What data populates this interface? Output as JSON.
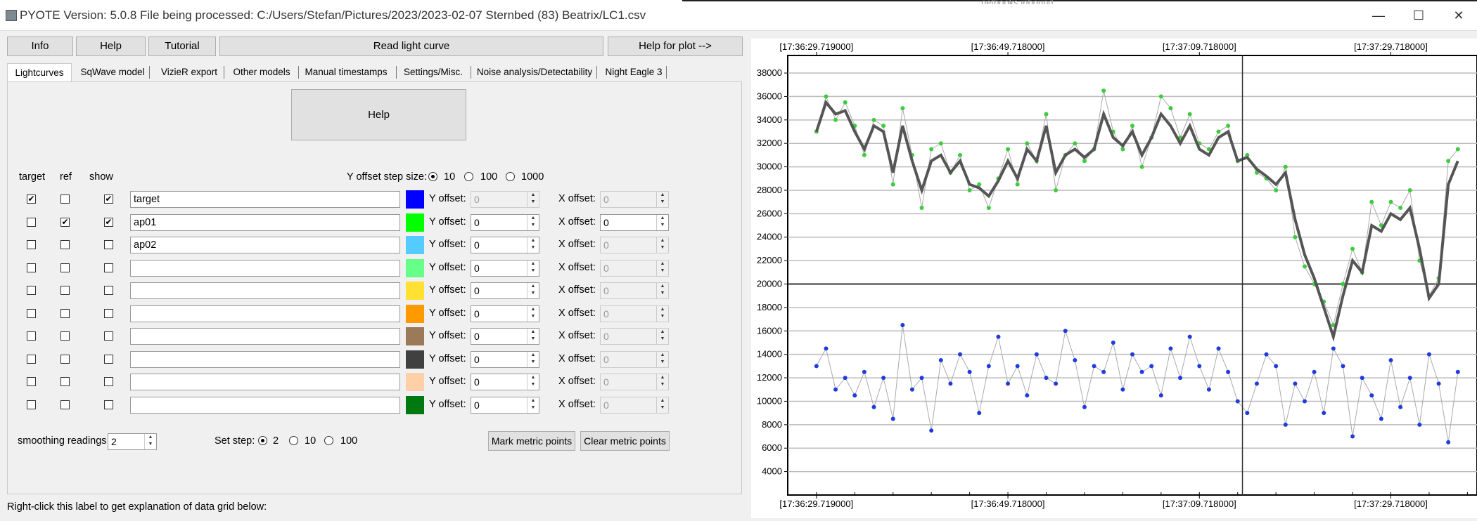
{
  "window": {
    "title": "PYOTE Version: 5.0.8  File being processed: C:/Users/Stefan/Pictures/2023/2023-02-07 Sternbed (83) Beatrix/LC1.csv",
    "ghost_text": "netbooks inbound",
    "min_symbol": "—",
    "max_symbol": "☐",
    "close_symbol": "✕"
  },
  "toolbar": {
    "info": "Info",
    "help": "Help",
    "tutorial": "Tutorial",
    "read_light_curve": "Read light curve",
    "help_for_plot": "Help for plot -->"
  },
  "tabs": [
    "Lightcurves",
    "SqWave model",
    "VizieR export",
    "Other models",
    "Manual timestamps",
    "Settings/Misc.",
    "Noise analysis/Detectability",
    "Night Eagle 3"
  ],
  "panel": {
    "help_button": "Help",
    "col_target": "target",
    "col_ref": "ref",
    "col_show": "show",
    "y_step_label": "Y offset step size:",
    "y_step_options": [
      "10",
      "100",
      "1000"
    ],
    "y_offset_label": "Y offset:",
    "x_offset_label": "X offset:",
    "rows": [
      {
        "target": true,
        "ref": false,
        "show": true,
        "name": "target",
        "color": "#0000ff",
        "y": "0",
        "x": "0",
        "y_enabled": false,
        "x_enabled": false
      },
      {
        "target": false,
        "ref": true,
        "show": true,
        "name": "ap01",
        "color": "#00ff00",
        "y": "0",
        "x": "0",
        "y_enabled": true,
        "x_enabled": true
      },
      {
        "target": false,
        "ref": false,
        "show": false,
        "name": "ap02",
        "color": "#55ccff",
        "y": "0",
        "x": "0",
        "y_enabled": true,
        "x_enabled": false
      },
      {
        "target": false,
        "ref": false,
        "show": false,
        "name": "",
        "color": "#66ff88",
        "y": "0",
        "x": "0",
        "y_enabled": true,
        "x_enabled": false
      },
      {
        "target": false,
        "ref": false,
        "show": false,
        "name": "",
        "color": "#ffe033",
        "y": "0",
        "x": "0",
        "y_enabled": true,
        "x_enabled": false
      },
      {
        "target": false,
        "ref": false,
        "show": false,
        "name": "",
        "color": "#ff9900",
        "y": "0",
        "x": "0",
        "y_enabled": true,
        "x_enabled": false
      },
      {
        "target": false,
        "ref": false,
        "show": false,
        "name": "",
        "color": "#9b7a5a",
        "y": "0",
        "x": "0",
        "y_enabled": true,
        "x_enabled": false
      },
      {
        "target": false,
        "ref": false,
        "show": false,
        "name": "",
        "color": "#404040",
        "y": "0",
        "x": "0",
        "y_enabled": true,
        "x_enabled": false
      },
      {
        "target": false,
        "ref": false,
        "show": false,
        "name": "",
        "color": "#ffd0a8",
        "y": "0",
        "x": "0",
        "y_enabled": true,
        "x_enabled": false
      },
      {
        "target": false,
        "ref": false,
        "show": false,
        "name": "",
        "color": "#007a10",
        "y": "0",
        "x": "0",
        "y_enabled": true,
        "x_enabled": false
      }
    ],
    "smoothing_label": "smoothing readings",
    "smoothing_value": "2",
    "set_step_label": "Set step:",
    "set_step_options": [
      "2",
      "10",
      "100"
    ],
    "mark_metric": "Mark metric points",
    "clear_metric": "Clear metric points"
  },
  "status_text": "Right-click this label to get explanation of data grid below:",
  "chart_data": {
    "type": "scatter",
    "x_tick_labels": [
      "[17:36:29.719000]",
      "[17:36:49.718000]",
      "[17:37:09.718000]",
      "[17:37:29.718000]"
    ],
    "y_ticks": [
      4000,
      6000,
      8000,
      10000,
      12000,
      14000,
      16000,
      18000,
      20000,
      22000,
      24000,
      26000,
      28000,
      30000,
      32000,
      34000,
      36000,
      38000
    ],
    "ylim": [
      2000,
      39500
    ],
    "xlim": [
      -3,
      69
    ],
    "grid": true,
    "cursor_x": 44.5,
    "series": [
      {
        "color": "#3ccc3c",
        "description": "ap01 readings",
        "x": [
          0,
          1,
          2,
          3,
          4,
          5,
          6,
          7,
          8,
          9,
          10,
          11,
          12,
          13,
          14,
          15,
          16,
          17,
          18,
          19,
          20,
          21,
          22,
          23,
          24,
          25,
          26,
          27,
          28,
          29,
          30,
          31,
          32,
          33,
          34,
          35,
          36,
          37,
          38,
          39,
          40,
          41,
          42,
          43,
          44,
          45,
          46,
          47,
          48,
          49,
          50,
          51,
          52,
          53,
          54,
          55,
          56,
          57,
          58,
          59,
          60,
          61,
          62,
          63,
          64,
          65,
          66,
          67
        ],
        "y": [
          33000,
          36000,
          34000,
          35500,
          33500,
          31000,
          34000,
          33500,
          28500,
          35000,
          31000,
          26500,
          31500,
          32000,
          29500,
          31000,
          28000,
          28500,
          26500,
          29000,
          31500,
          28500,
          32000,
          30500,
          34500,
          28000,
          31000,
          32000,
          30500,
          31500,
          36500,
          33000,
          31500,
          33500,
          30000,
          32500,
          36000,
          35000,
          32500,
          34500,
          32000,
          31500,
          33000,
          33500,
          30500,
          31000,
          29500,
          29000,
          28000,
          30000,
          24000,
          21500,
          20000,
          18500,
          16500,
          20000,
          23000,
          21000,
          27000,
          25000,
          27000,
          26500,
          28000,
          22000,
          19000,
          20500,
          30500,
          31500
        ]
      },
      {
        "color": "#555555",
        "description": "ap01 smoothed",
        "x": [
          0,
          1,
          2,
          3,
          4,
          5,
          6,
          7,
          8,
          9,
          10,
          11,
          12,
          13,
          14,
          15,
          16,
          17,
          18,
          19,
          20,
          21,
          22,
          23,
          24,
          25,
          26,
          27,
          28,
          29,
          30,
          31,
          32,
          33,
          34,
          35,
          36,
          37,
          38,
          39,
          40,
          41,
          42,
          43,
          44,
          45,
          46,
          47,
          48,
          49,
          50,
          51,
          52,
          53,
          54,
          55,
          56,
          57,
          58,
          59,
          60,
          61,
          62,
          63,
          64,
          65,
          66,
          67
        ],
        "y": [
          33000,
          35500,
          34500,
          34800,
          33000,
          31500,
          33500,
          33000,
          29500,
          33500,
          30500,
          28000,
          30500,
          31000,
          29500,
          30500,
          28500,
          28200,
          27500,
          28800,
          30500,
          29000,
          31500,
          30500,
          33500,
          29500,
          31000,
          31500,
          30800,
          31500,
          34500,
          32500,
          31800,
          33000,
          31000,
          32500,
          34500,
          33500,
          32000,
          33500,
          31500,
          31000,
          32500,
          33000,
          30500,
          30800,
          29800,
          29200,
          28500,
          29500,
          25500,
          22500,
          20500,
          18000,
          15500,
          19000,
          22000,
          21000,
          25000,
          24500,
          26000,
          25500,
          26500,
          23000,
          18800,
          20000,
          28500,
          30500
        ]
      },
      {
        "color": "#1f3bdc",
        "description": "target readings",
        "x": [
          0,
          1,
          2,
          3,
          4,
          5,
          6,
          7,
          8,
          9,
          10,
          11,
          12,
          13,
          14,
          15,
          16,
          17,
          18,
          19,
          20,
          21,
          22,
          23,
          24,
          25,
          26,
          27,
          28,
          29,
          30,
          31,
          32,
          33,
          34,
          35,
          36,
          37,
          38,
          39,
          40,
          41,
          42,
          43,
          44,
          45,
          46,
          47,
          48,
          49,
          50,
          51,
          52,
          53,
          54,
          55,
          56,
          57,
          58,
          59,
          60,
          61,
          62,
          63,
          64,
          65,
          66,
          67
        ],
        "y": [
          13000,
          14500,
          11000,
          12000,
          10500,
          12500,
          9500,
          12000,
          8500,
          16500,
          11000,
          12000,
          7500,
          13500,
          11500,
          14000,
          12500,
          9000,
          13000,
          15500,
          11500,
          13000,
          10500,
          14000,
          12000,
          11500,
          16000,
          13500,
          9500,
          13000,
          12500,
          15000,
          11000,
          14000,
          12500,
          13000,
          10500,
          14500,
          12000,
          15500,
          13000,
          11000,
          14500,
          12500,
          10000,
          9000,
          11500,
          14000,
          13000,
          8000,
          11500,
          10000,
          12500,
          9000,
          14500,
          13000,
          7000,
          12000,
          10500,
          8500,
          13500,
          9500,
          12000,
          8000,
          14000,
          11500,
          6500,
          12500
        ]
      }
    ]
  }
}
